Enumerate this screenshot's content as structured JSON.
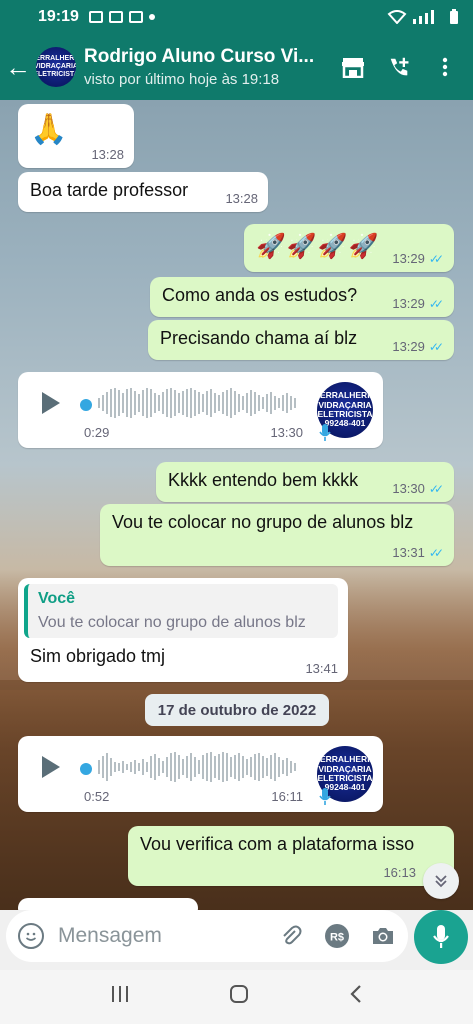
{
  "status": {
    "time": "19:19"
  },
  "header": {
    "avatar_lines": [
      "SERRALHERIA",
      "VIDRAÇARIA",
      "ELETRICISTA",
      "99248-401"
    ],
    "contact_name": "Rodrigo Aluno Curso Vi...",
    "last_seen": "visto por último hoje às 19:18"
  },
  "messages": [
    {
      "dir": "in",
      "text": "🙏",
      "time": "13:28"
    },
    {
      "dir": "in",
      "text": "Boa tarde professor",
      "time": "13:28"
    },
    {
      "dir": "out",
      "text": "🚀🚀🚀🚀",
      "time": "13:29"
    },
    {
      "dir": "out",
      "text": "Como anda os estudos?",
      "time": "13:29"
    },
    {
      "dir": "out",
      "text": "Precisando chama aí blz",
      "time": "13:29"
    },
    {
      "dir": "in",
      "type": "voice",
      "duration": "0:29",
      "time": "13:30"
    },
    {
      "dir": "out",
      "text": "Kkkk entendo bem kkkk",
      "time": "13:30"
    },
    {
      "dir": "out",
      "text": "Vou te colocar no grupo de alunos blz",
      "time": "13:31"
    },
    {
      "dir": "in",
      "quote_author": "Você",
      "quote_text": "Vou te colocar no grupo de alunos blz",
      "text": "Sim obrigado tmj",
      "time": "13:41"
    },
    {
      "dir": "in",
      "type": "voice",
      "duration": "0:52",
      "time": "16:11"
    },
    {
      "dir": "out",
      "text": "Vou verifica com a plataforma isso",
      "time": "16:13"
    }
  ],
  "date_chip": "17 de outubro de 2022",
  "composer": {
    "placeholder": "Mensagem",
    "currency_label": "R$"
  },
  "colors": {
    "primary": "#0f7a6b",
    "outgoing": "#dcf8c6",
    "incoming": "#ffffff",
    "read_ticks": "#34b7f1",
    "mic_button": "#1aa391"
  }
}
